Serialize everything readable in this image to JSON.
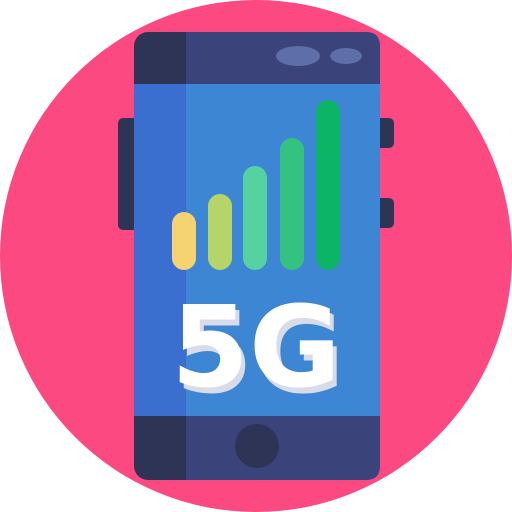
{
  "icon": {
    "name": "5g-smartphone-icon",
    "label": "5G",
    "signal_level": 5,
    "signal_max": 5,
    "colors": {
      "background_circle": "#FC4981",
      "phone_body": "#2E3456",
      "phone_body_right": "#3A437A",
      "screen_left": "#3A6FD0",
      "screen_right": "#3C86D4",
      "speaker": "#5E6EA8",
      "home_button": "#2E3456",
      "label_text": "#FFFFFF",
      "label_shadow": "#D8DCE8",
      "bar_1": "#F5D272",
      "bar_2": "#B5D46A",
      "bar_3": "#55D2A0",
      "bar_4": "#35C280",
      "bar_5": "#0CB565"
    }
  }
}
